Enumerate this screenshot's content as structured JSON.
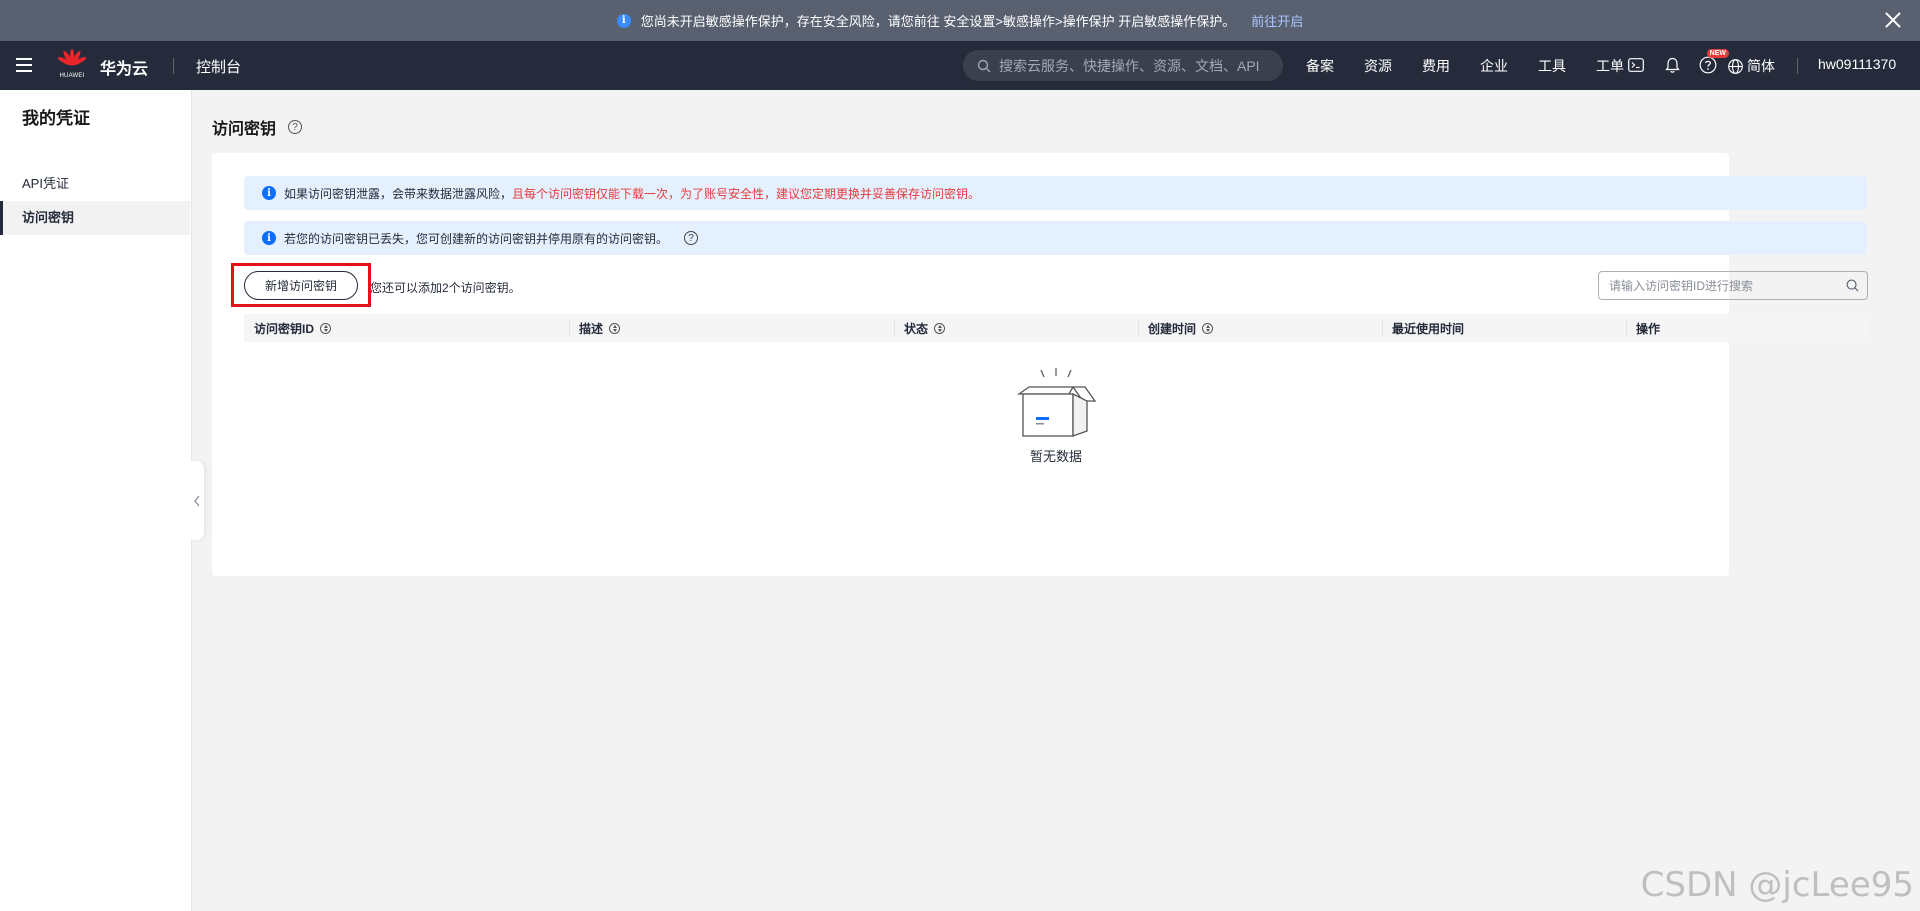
{
  "notice": {
    "text": "您尚未开启敏感操作保护，存在安全风险，请您前往 安全设置>敏感操作>操作保护 开启敏感操作保护。",
    "link": "前往开启"
  },
  "topnav": {
    "logo_text": "HUAWEI",
    "brand": "华为云",
    "console": "控制台",
    "search_placeholder": "搜索云服务、快捷操作、资源、文档、API",
    "items": [
      "备案",
      "资源",
      "费用",
      "企业",
      "工具",
      "工单"
    ],
    "new_badge": "NEW",
    "language": "简体",
    "username": "hw09111370"
  },
  "sidebar": {
    "title": "我的凭证",
    "items": [
      {
        "label": "API凭证",
        "active": false
      },
      {
        "label": "访问密钥",
        "active": true
      }
    ]
  },
  "main": {
    "title": "访问密钥",
    "alerts": [
      {
        "normal": "如果访问密钥泄露，会带来数据泄露风险，",
        "danger": "且每个访问密钥仅能下载一次，为了账号安全性，建议您定期更换并妥善保存访问密钥。"
      },
      {
        "normal": "若您的访问密钥已丢失，您可创建新的访问密钥并停用原有的访问密钥。",
        "danger": ""
      }
    ],
    "create_button": "新增访问密钥",
    "remaining_text": "您还可以添加2个访问密钥。",
    "search_placeholder": "请输入访问密钥ID进行搜索",
    "columns": [
      "访问密钥ID",
      "描述",
      "状态",
      "创建时间",
      "最近使用时间",
      "操作"
    ],
    "empty_text": "暂无数据"
  },
  "watermark": "CSDN @jcLee95",
  "colors": {
    "notice_bg": "#596070",
    "nav_bg": "#252b3a",
    "alert_bg": "#e5f0ff",
    "danger": "#e53b3b",
    "highlight": "#e3131b",
    "info_blue": "#0d6efd"
  }
}
